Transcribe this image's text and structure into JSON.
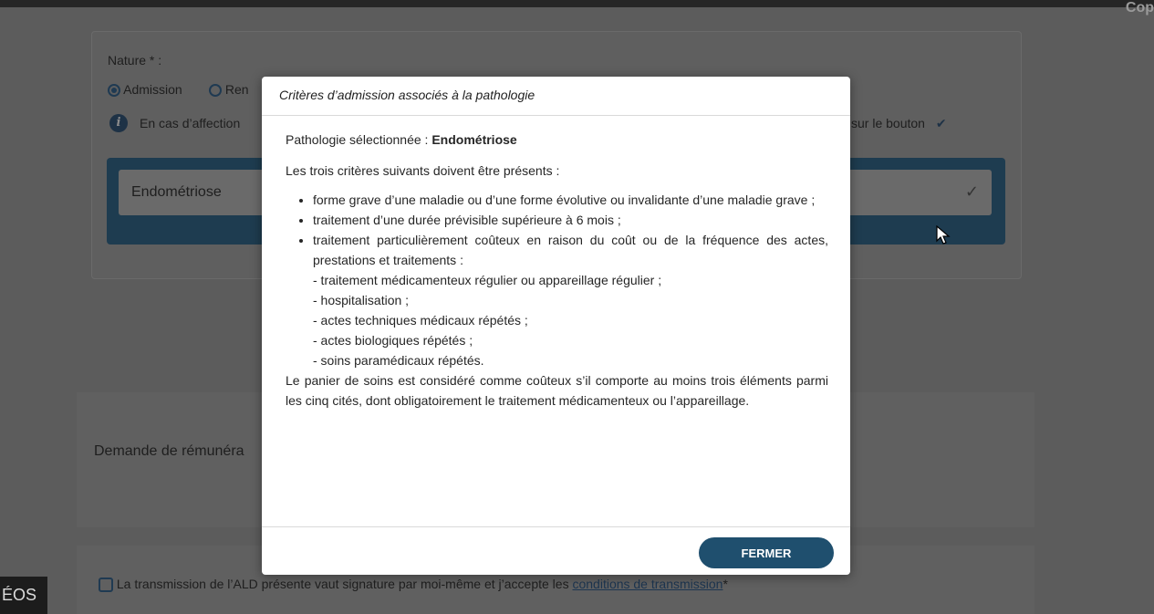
{
  "background": {
    "corner_text": "Cop",
    "nature_label": "Nature * :",
    "radio_admission": "Admission",
    "radio_renouvellement": "Ren",
    "info_text": "En cas d’affection",
    "info_text_right": "sur le bouton",
    "pathology_value": "Endométriose",
    "demande_label": "Demande de rémunéra",
    "transmission_text": "La transmission de l’ALD présente vaut signature par moi-même et j’accepte les",
    "transmission_link": "conditions de transmission",
    "transmission_asterisk": "*",
    "videos_label": "ÉOS"
  },
  "modal": {
    "title": "Critères d’admission associés à la pathologie",
    "selected_prefix": "Pathologie sélectionnée : ",
    "selected_value": "Endométriose",
    "intro": "Les trois critères suivants doivent être présents :",
    "criteria": [
      "forme grave d’une maladie ou d’une forme évolutive ou invalidante d’une maladie grave ;",
      "traitement d’une durée prévisible supérieure à 6 mois ;",
      "traitement particulièrement coûteux en raison du coût ou de la fréquence des actes, prestations et traitements :"
    ],
    "subitems": [
      "- traitement médicamenteux régulier ou appareillage régulier ;",
      "- hospitalisation ;",
      "- actes techniques médicaux répétés ;",
      "- actes biologiques répétés ;",
      "- soins paramédicaux répétés."
    ],
    "closing": "Le panier de soins est considéré comme coûteux s’il comporte au moins trois éléments parmi les cinq cités, dont obligatoirement le traitement médicamenteux ou l’appareillage.",
    "close_button": "FERMER"
  },
  "colors": {
    "primary": "#1f4f6e",
    "overlay": "#5c5c5c"
  }
}
